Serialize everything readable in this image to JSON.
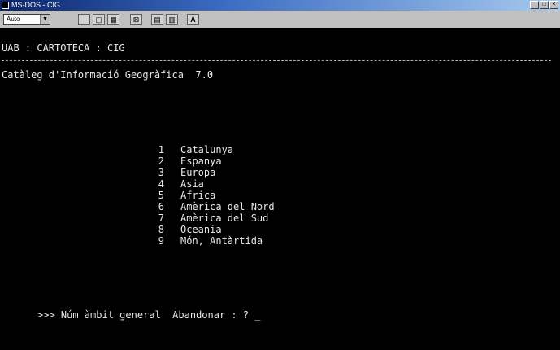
{
  "window": {
    "title": "MS-DOS - CIG"
  },
  "toolbar": {
    "font_size": "Auto"
  },
  "terminal": {
    "header": "UAB : CARTOTECA : CIG",
    "catalog_title": "Catàleg d'Informació Geogràfica  7.0",
    "menu": [
      {
        "num": "1",
        "label": "Catalunya"
      },
      {
        "num": "2",
        "label": "Espanya"
      },
      {
        "num": "3",
        "label": "Europa"
      },
      {
        "num": "4",
        "label": "Asia"
      },
      {
        "num": "5",
        "label": "Africa"
      },
      {
        "num": "6",
        "label": "Amèrica del Nord"
      },
      {
        "num": "7",
        "label": "Amèrica del Sud"
      },
      {
        "num": "8",
        "label": "Oceania"
      },
      {
        "num": "9",
        "label": "Món, Antàrtida"
      }
    ],
    "prompt": ">>> Núm àmbit general  Abandonar : ? _"
  }
}
